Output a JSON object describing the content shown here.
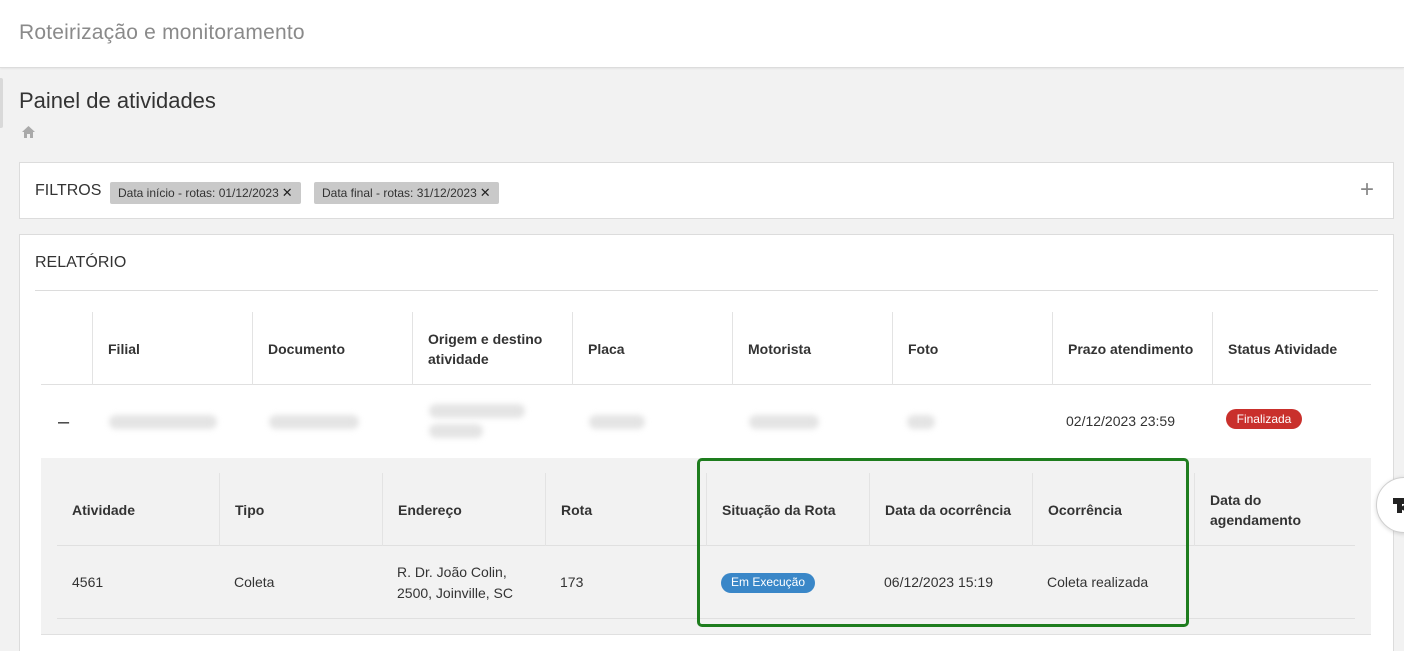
{
  "app": {
    "title": "Roteirização e monitoramento"
  },
  "page": {
    "title": "Painel de atividades"
  },
  "filters": {
    "label": "FILTROS",
    "chips": [
      {
        "label": "Data início - rotas: 01/12/2023"
      },
      {
        "label": "Data final - rotas: 31/12/2023"
      }
    ],
    "remove_glyph": "✕",
    "add_glyph": "+"
  },
  "report": {
    "label": "RELATÓRIO",
    "columns": [
      "Filial",
      "Documento",
      "Origem e destino atividade",
      "Placa",
      "Motorista",
      "Foto",
      "Prazo atendimento",
      "Status Atividade"
    ],
    "row": {
      "collapse_glyph": "–",
      "prazo": "02/12/2023 23:59",
      "status": "Finalizada"
    },
    "detail": {
      "columns": [
        "Atividade",
        "Tipo",
        "Endereço",
        "Rota",
        "Situação da Rota",
        "Data da ocorrência",
        "Ocorrência",
        "Data do agendamento"
      ],
      "row": {
        "atividade": "4561",
        "tipo": "Coleta",
        "endereco": "R. Dr. João Colin, 2500, Joinville, SC",
        "rota": "173",
        "situacao": "Em Execução",
        "data_ocorrencia": "06/12/2023 15:19",
        "ocorrencia": "Coleta realizada",
        "data_agendamento": ""
      }
    }
  },
  "colors": {
    "status_finalizada": "#c9302c",
    "status_em_execucao": "#3a87c8",
    "highlight": "#1e7d1e"
  }
}
